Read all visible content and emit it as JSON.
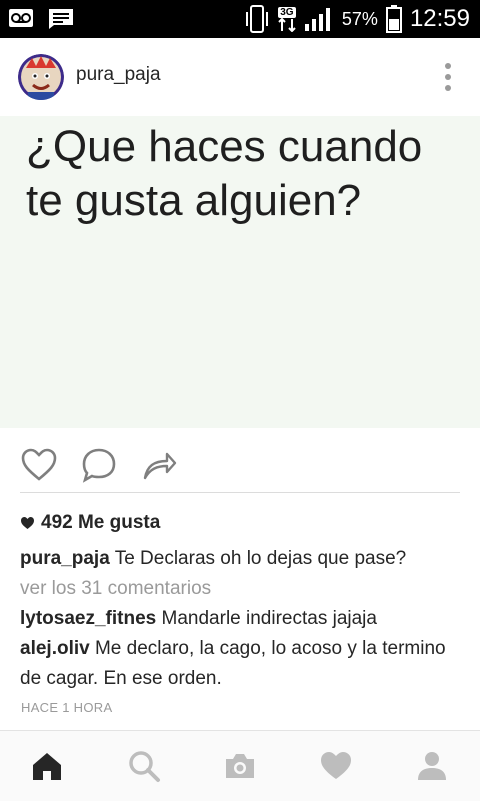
{
  "status_bar": {
    "network": "3G",
    "battery": "57%",
    "time": "12:59",
    "icons": [
      "voicemail-icon",
      "message-icon",
      "vibrate-icon",
      "network-icon",
      "signal-icon",
      "battery-icon"
    ]
  },
  "post": {
    "username": "pura_paja",
    "image_text": "¿Que haces cuando\nte gusta alguien?",
    "likes": "492 Me gusta",
    "caption": {
      "user": "pura_paja",
      "text": "Te Declaras oh lo dejas que pase?"
    },
    "view_comments": "ver los 31 comentarios",
    "comments": [
      {
        "user": "lytosaez_fitnes",
        "text": "Mandarle indirectas jajaja"
      },
      {
        "user": "alej.oliv",
        "text": "Me declaro, la cago, lo acoso y la termino de cagar. En ese orden."
      }
    ],
    "timestamp": "HACE 1 HORA"
  },
  "actions": [
    "heart-icon",
    "comment-icon",
    "share-icon"
  ],
  "bottom_nav": [
    "home-icon",
    "search-icon",
    "camera-icon",
    "activity-heart-icon",
    "profile-icon"
  ],
  "colors": {
    "text": "#262626",
    "muted": "#9a9a9a",
    "image_bg": "#f3f8f2"
  }
}
